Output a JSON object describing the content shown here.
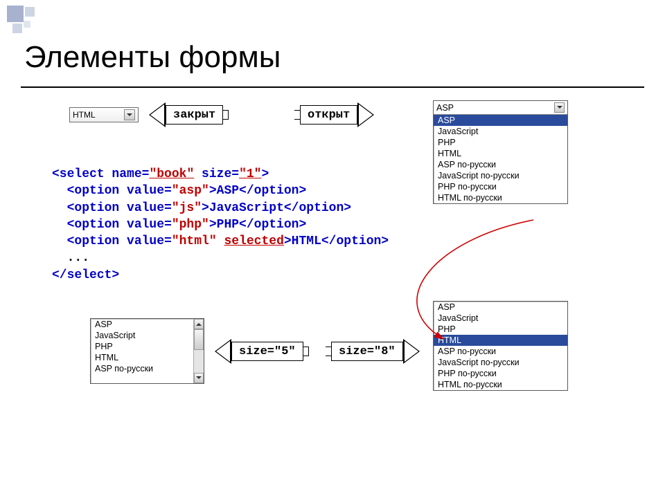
{
  "title": "Элементы формы",
  "labels": {
    "closed": "закрыт",
    "open": "открыт",
    "size5": "size=\"5\"",
    "size8": "size=\"8\""
  },
  "closedSelect": {
    "value": "HTML"
  },
  "openSelect": {
    "headValue": "ASP",
    "options": [
      "ASP",
      "JavaScript",
      "PHP",
      "HTML",
      "ASP по-русски",
      "JavaScript по-русски",
      "PHP по-русски",
      "HTML по-русски"
    ],
    "selectedIndex": 0
  },
  "size5List": {
    "options": [
      "ASP",
      "JavaScript",
      "PHP",
      "HTML",
      "ASP по-русски"
    ]
  },
  "size8List": {
    "options": [
      "ASP",
      "JavaScript",
      "PHP",
      "HTML",
      "ASP по-русски",
      "JavaScript по-русски",
      "PHP по-русски",
      "HTML по-русски"
    ],
    "selectedIndex": 3
  },
  "code": {
    "l1a": "<select name=",
    "l1b": "\"book\"",
    "l1c": " size=",
    "l1d": "\"1\"",
    "l1e": ">",
    "l2a": "  <option value=",
    "l2b": "\"asp\"",
    "l2c": ">ASP</option>",
    "l3a": "  <option value=",
    "l3b": "\"js\"",
    "l3c": ">JavaScript</option>",
    "l4a": "  <option value=",
    "l4b": "\"php\"",
    "l4c": ">PHP</option>",
    "l5a": "  <option value=",
    "l5b": "\"html\"",
    "l5c": " ",
    "l5d": "selected",
    "l5e": ">HTML</option>",
    "l6": "  ...",
    "l7": "</select>"
  }
}
